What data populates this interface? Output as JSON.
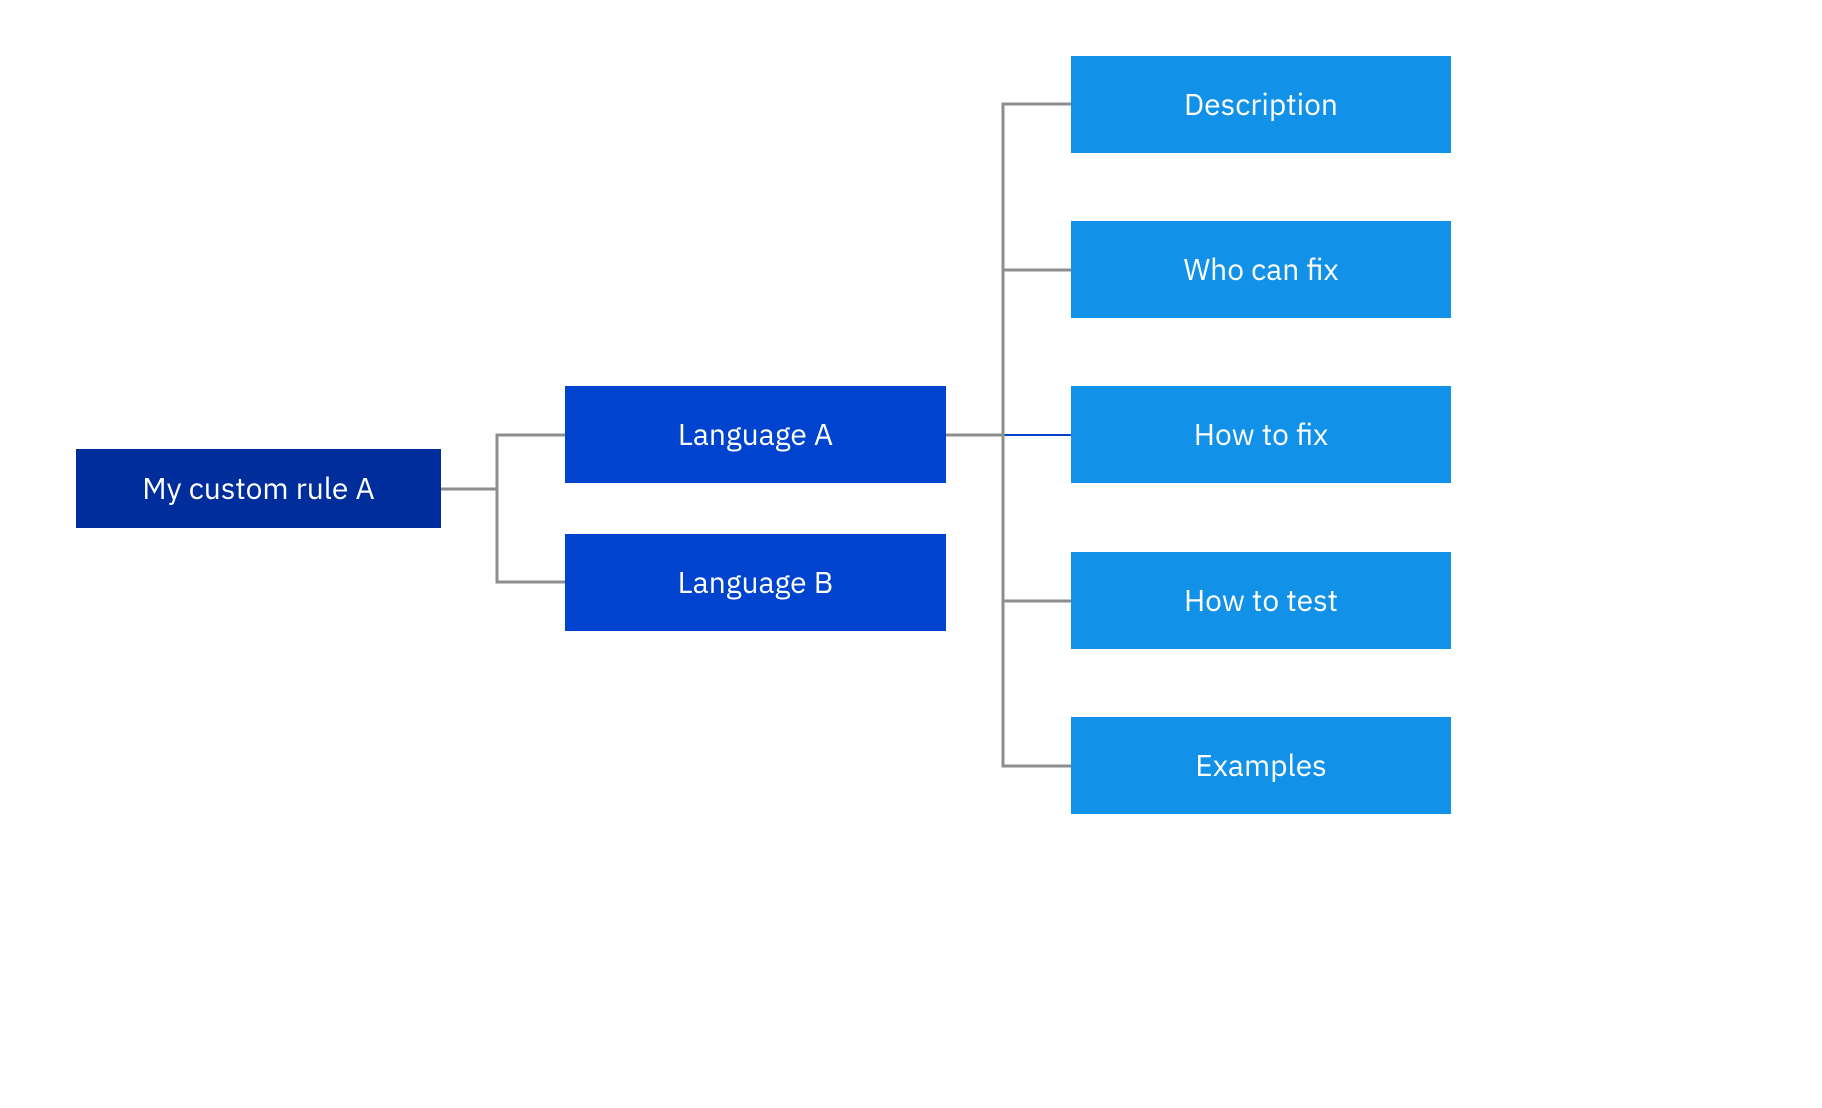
{
  "colors": {
    "root": "#002d9c",
    "branch": "#0043ce",
    "leaf": "#1192e8",
    "connector": "#8d8d8d",
    "special_connector": "#0043ce"
  },
  "root": {
    "label": "My custom rule A"
  },
  "branches": [
    {
      "label": "Language A"
    },
    {
      "label": "Language B"
    }
  ],
  "leaves": [
    {
      "label": "Description"
    },
    {
      "label": "Who can fix"
    },
    {
      "label": "How to fix"
    },
    {
      "label": "How to test"
    },
    {
      "label": "Examples"
    }
  ]
}
